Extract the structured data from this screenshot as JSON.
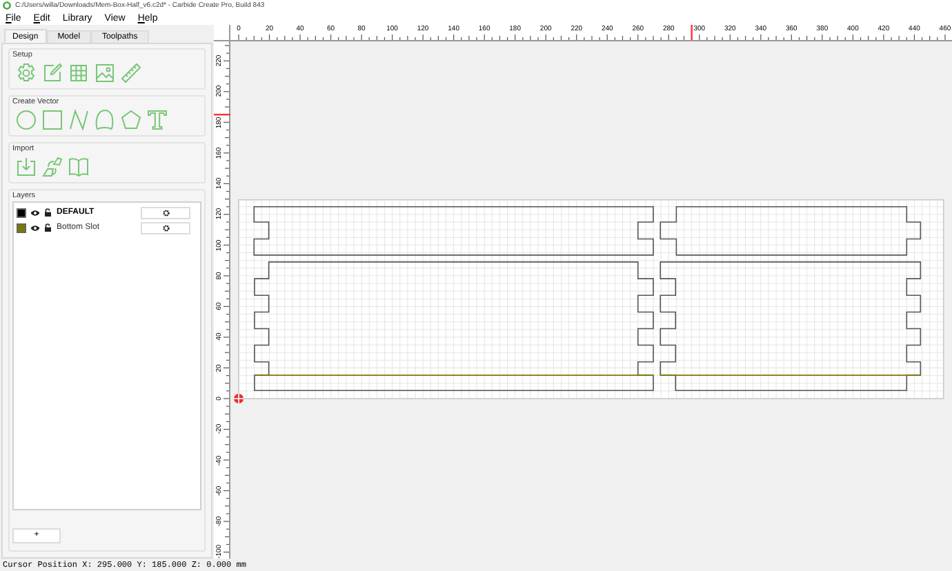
{
  "window": {
    "title": "C:/Users/willa/Downloads/Mem-Box-Half_v6.c2d* - Carbide Create Pro, Build 843"
  },
  "menu": [
    {
      "label": "File",
      "underline_first": true
    },
    {
      "label": "Edit",
      "underline_first": true
    },
    {
      "label": "Library",
      "underline_first": false
    },
    {
      "label": "View",
      "underline_first": false
    },
    {
      "label": "Help",
      "underline_first": true
    }
  ],
  "tabs": [
    {
      "label": "Design",
      "selected": true
    },
    {
      "label": "Model",
      "selected": false
    },
    {
      "label": "Toolpaths",
      "selected": false
    }
  ],
  "sections": [
    {
      "title": "Setup"
    },
    {
      "title": "Create Vector"
    },
    {
      "title": "Import"
    }
  ],
  "layers": {
    "title": "Layers",
    "items": [
      {
        "name": "DEFAULT",
        "color": "#000000",
        "active": true
      },
      {
        "name": "Bottom Slot",
        "color": "#7a7a00",
        "active": false
      }
    ],
    "add_button": "+"
  },
  "rulers": {
    "x_labels": [
      "0",
      "20",
      "40",
      "60",
      "80",
      "100",
      "120",
      "140",
      "160",
      "180",
      "200",
      "220",
      "240",
      "260",
      "280",
      "300",
      "320",
      "340",
      "360",
      "380",
      "400",
      "420",
      "440",
      "460"
    ],
    "y_labels": [
      "220",
      "200",
      "180",
      "160",
      "140",
      "120",
      "100",
      "80",
      "60",
      "40",
      "20",
      "0",
      "-20",
      "-40",
      "-60",
      "-80",
      "-100"
    ]
  },
  "status_bar": "Cursor Position X: 295.000 Y: 185.000 Z: 0.000 mm"
}
